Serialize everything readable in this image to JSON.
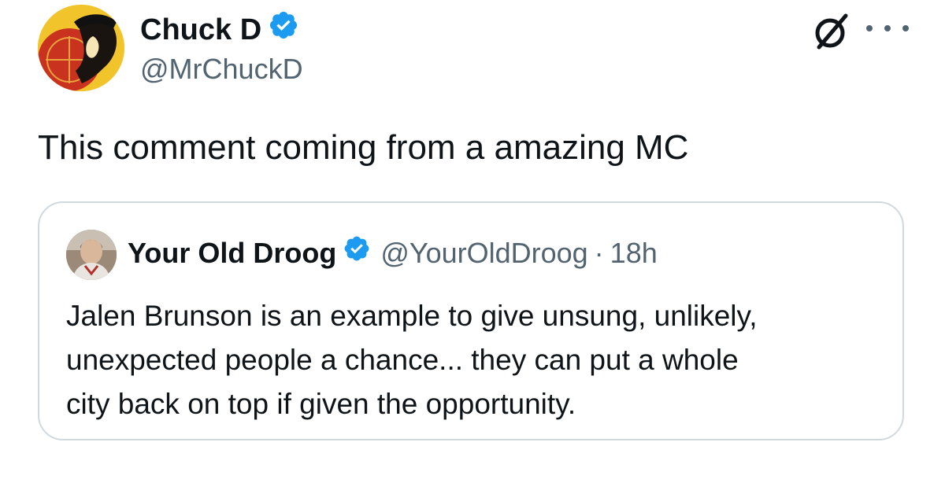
{
  "tweet": {
    "author": {
      "display_name": "Chuck D",
      "handle": "@MrChuckD",
      "verified": true,
      "avatar": "chuck-d-avatar"
    },
    "text": "This comment coming from a amazing MC",
    "actions": {
      "grok_icon": "grok-icon",
      "more_icon": "more-options-icon"
    }
  },
  "quoted_tweet": {
    "author": {
      "display_name": "Your Old Droog",
      "handle": "@YourOldDroog",
      "verified": true,
      "avatar": "your-old-droog-avatar"
    },
    "separator": "·",
    "time": "18h",
    "text_lines": [
      "Jalen Brunson is an example to give unsung, unlikely,",
      "unexpected people a chance... they can put a whole",
      "city back on top if given the opportunity."
    ]
  },
  "colors": {
    "text_primary": "#0f1419",
    "text_secondary": "#536471",
    "verified_blue": "#1d9bf0",
    "card_border": "#cfd9de"
  }
}
